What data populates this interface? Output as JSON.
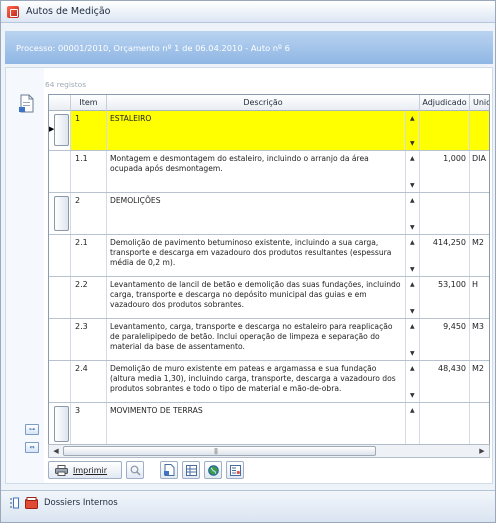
{
  "window": {
    "title": "Autos de Medição"
  },
  "process": {
    "text": "Processo: 00001/2010, Orçamento nº 1 de 06.04.2010 - Auto nº 6"
  },
  "grid": {
    "record_count": "64 registos",
    "columns": {
      "item": "Item",
      "description": "Descrição",
      "adjudicado": "Adjudicado",
      "unit": "Unid"
    },
    "rows": [
      {
        "item": "1",
        "description": "ESTALEIRO",
        "adjudicado": "",
        "unit": ""
      },
      {
        "item": "1.1",
        "description": "Montagem e desmontagem do estaleiro, incluindo o arranjo da área ocupada após desmontagem.",
        "adjudicado": "1,000",
        "unit": "DIA"
      },
      {
        "item": "2",
        "description": "DEMOLIÇÕES",
        "adjudicado": "",
        "unit": ""
      },
      {
        "item": "2.1",
        "description": "Demolição de pavimento betuminoso existente, incluindo a sua carga, transporte e descarga em vazadouro dos produtos resultantes (espessura média de 0,2 m).",
        "adjudicado": "414,250",
        "unit": "M2"
      },
      {
        "item": "2.2",
        "description": "Levantamento de lancil de betão e demolição das suas fundações, incluindo carga, transporte e descarga no depósito municipal das guias e em vazadouro dos produtos sobrantes.",
        "adjudicado": "53,100",
        "unit": "H"
      },
      {
        "item": "2.3",
        "description": "Levantamento, carga, transporte e descarga no estaleiro para reaplicação de paralelipipedo de betão. Inclui operação de limpeza e separação do material da base de assentamento.",
        "adjudicado": "9,450",
        "unit": "M3"
      },
      {
        "item": "2.4",
        "description": "Demolição de muro existente em pateas e argamassa e sua fundação (altura media 1,30), incluindo carga, transporte, descarga a vazadouro dos produtos sobrantes e todo o tipo de material e mão-de-obra.",
        "adjudicado": "48,430",
        "unit": "M2"
      },
      {
        "item": "3",
        "description": "MOVIMENTO DE TERRAS",
        "adjudicado": "",
        "unit": ""
      }
    ]
  },
  "toolbar": {
    "print_label": "Imprimir"
  },
  "taskbar": {
    "item_label": "Dossiers Internos"
  },
  "colors": {
    "selected_row": "#ffff00",
    "header_band": "#9fc1ea"
  }
}
